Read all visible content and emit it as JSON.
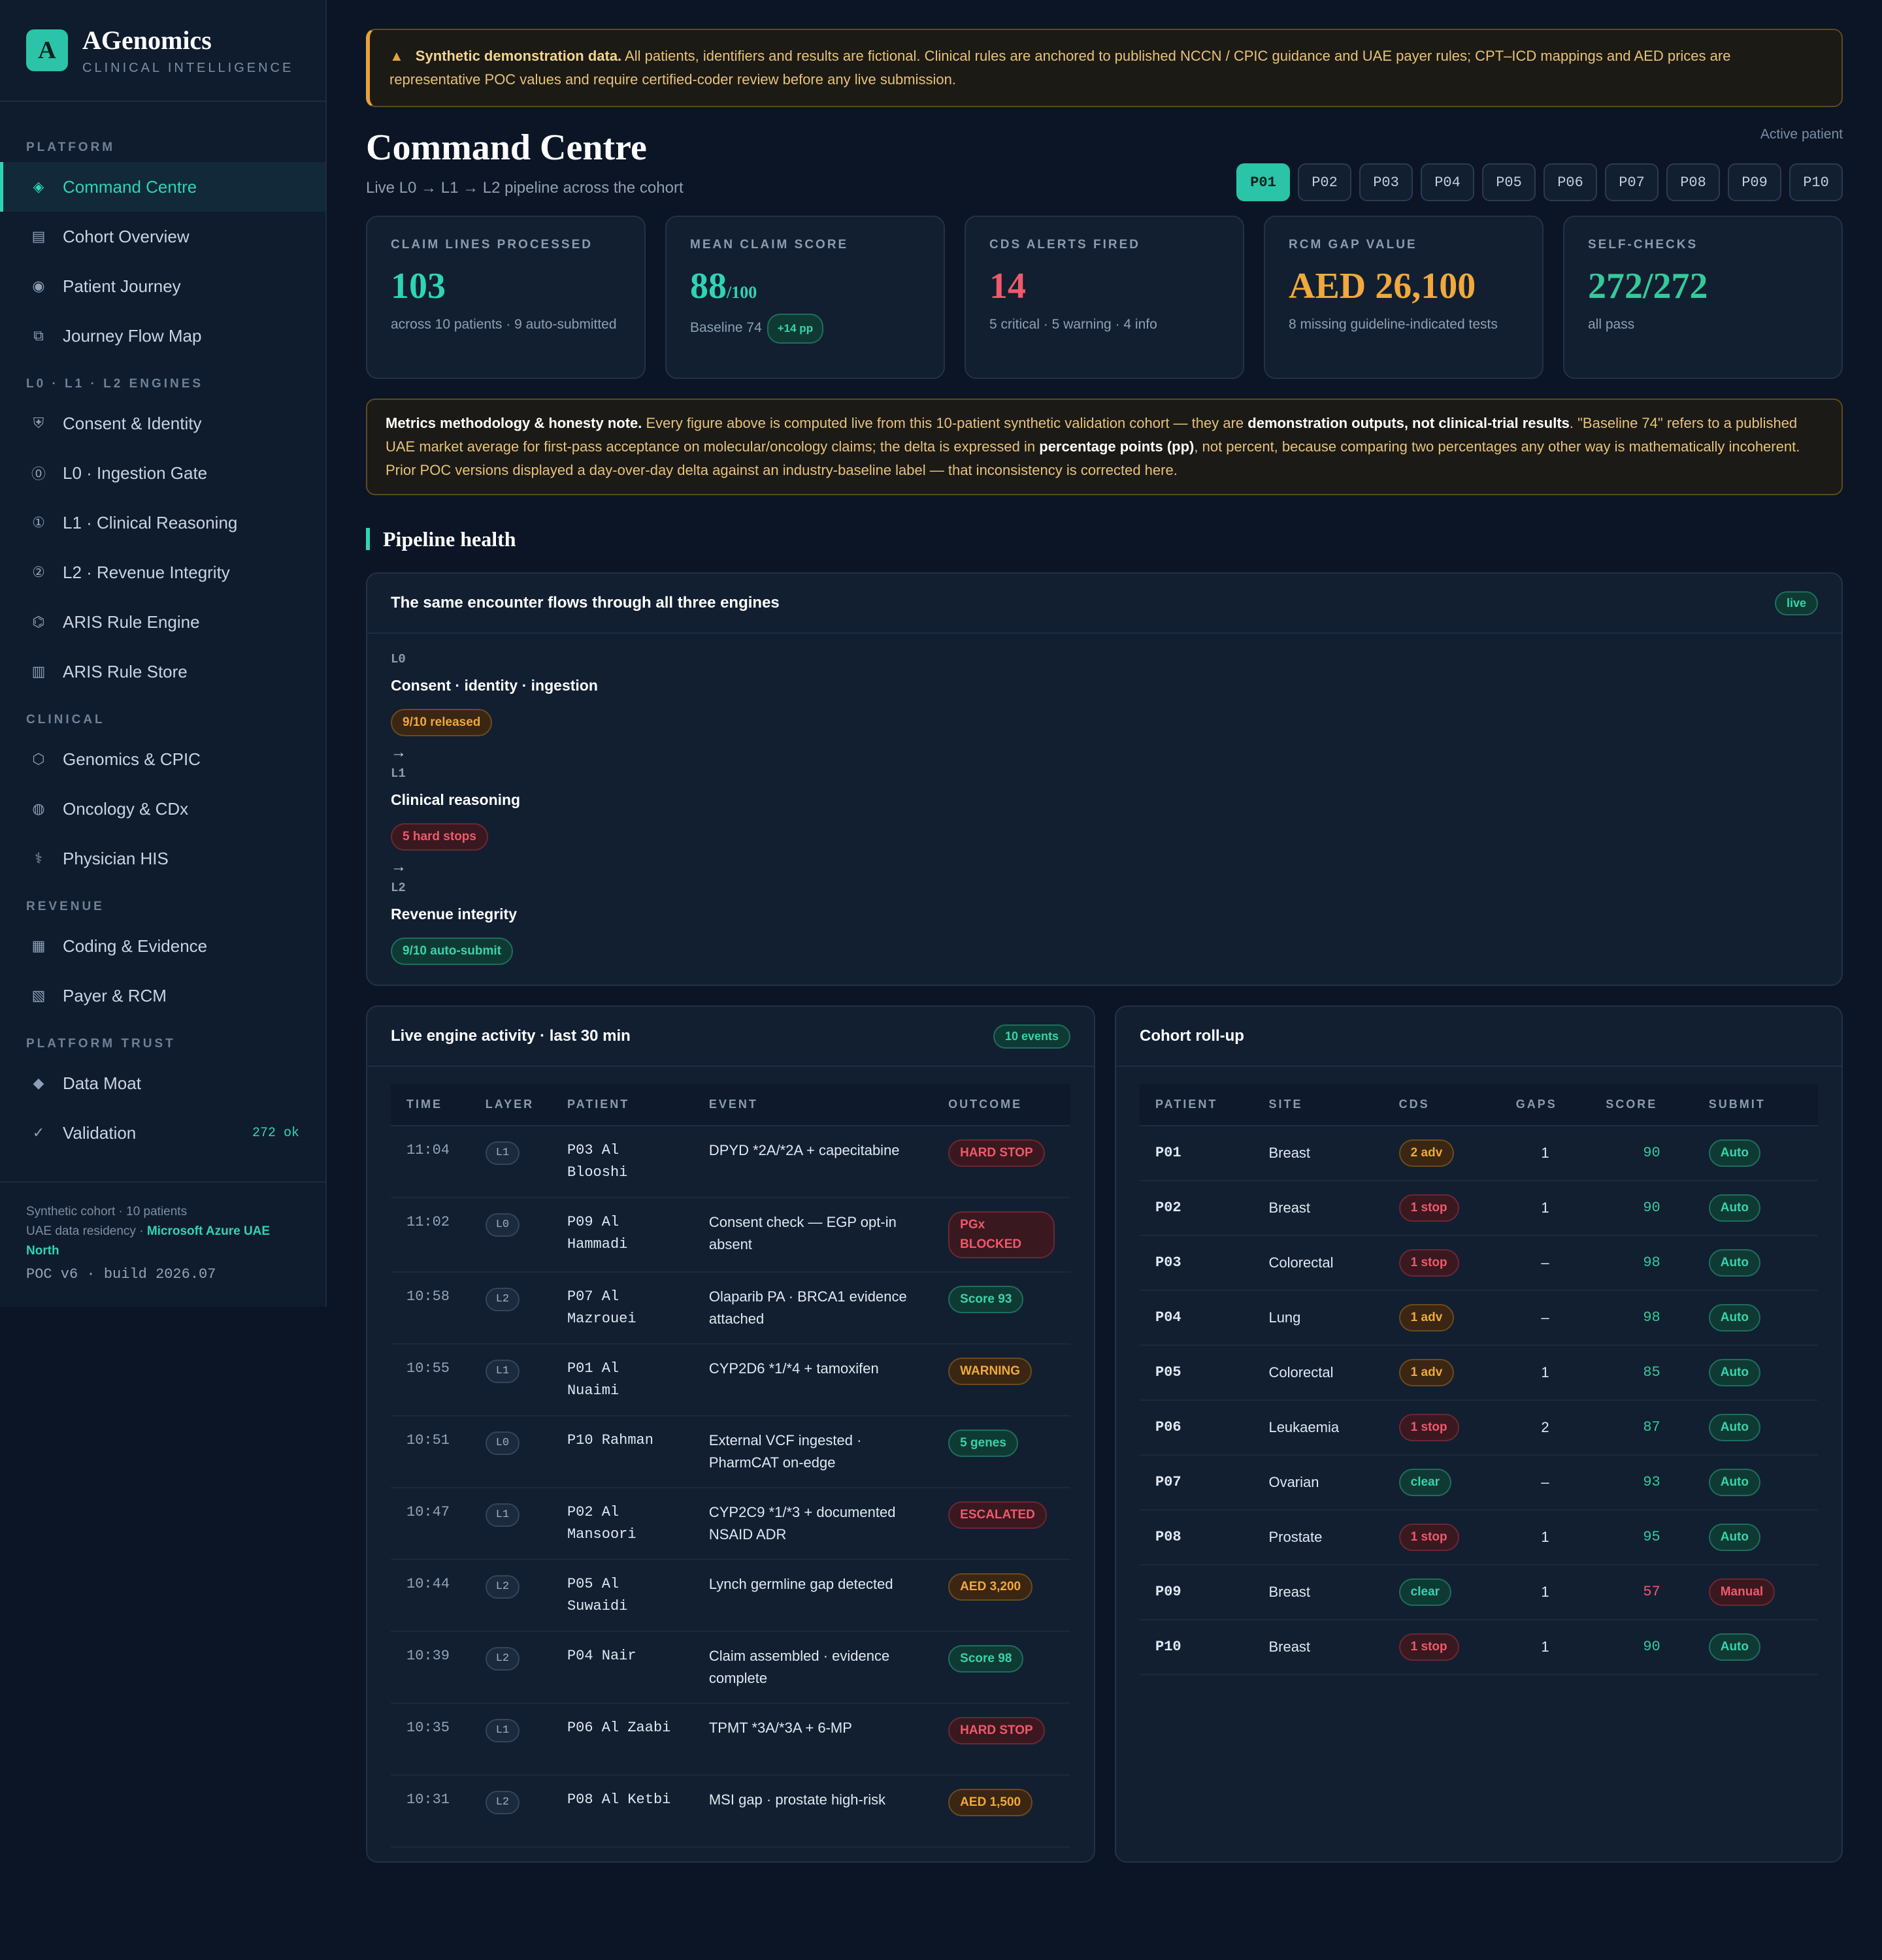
{
  "brand": {
    "logo_letter": "A",
    "title": "AGenomics",
    "subtitle": "CLINICAL INTELLIGENCE"
  },
  "sidebar": {
    "sections": [
      {
        "label": "PLATFORM",
        "items": [
          {
            "label": "Command Centre",
            "icon": "diamond-icon",
            "active": true
          },
          {
            "label": "Cohort Overview",
            "icon": "grid-icon"
          },
          {
            "label": "Patient Journey",
            "icon": "target-icon"
          },
          {
            "label": "Journey Flow Map",
            "icon": "layers-icon"
          }
        ]
      },
      {
        "label": "L0 · L1 · L2 ENGINES",
        "items": [
          {
            "label": "Consent & Identity",
            "icon": "shield-icon"
          },
          {
            "label": "L0 · Ingestion Gate",
            "icon": "circle-zero-icon"
          },
          {
            "label": "L1 · Clinical Reasoning",
            "icon": "circle-one-icon"
          },
          {
            "label": "L2 · Revenue Integrity",
            "icon": "circle-two-icon"
          },
          {
            "label": "ARIS Rule Engine",
            "icon": "hexagon-icon"
          },
          {
            "label": "ARIS Rule Store",
            "icon": "database-icon"
          }
        ]
      },
      {
        "label": "CLINICAL",
        "items": [
          {
            "label": "Genomics & CPIC",
            "icon": "hexagon-outline-icon"
          },
          {
            "label": "Oncology & CDx",
            "icon": "globe-icon"
          },
          {
            "label": "Physician HIS",
            "icon": "caduceus-icon"
          }
        ]
      },
      {
        "label": "REVENUE",
        "items": [
          {
            "label": "Coding & Evidence",
            "icon": "barcode-icon"
          },
          {
            "label": "Payer & RCM",
            "icon": "hatched-square-icon"
          }
        ]
      },
      {
        "label": "PLATFORM TRUST",
        "items": [
          {
            "label": "Data Moat",
            "icon": "diamond-solid-icon"
          },
          {
            "label": "Validation",
            "icon": "check-icon",
            "count": "272 ok"
          }
        ]
      }
    ],
    "footer": {
      "line1": "Synthetic cohort · 10 patients",
      "line2_prefix": "UAE data residency · ",
      "line2_highlight": "Microsoft Azure UAE North",
      "build": "POC v6 · build 2026.07"
    }
  },
  "banner": {
    "icon": "warning-icon",
    "bold": "Synthetic demonstration data.",
    "text": " All patients, identifiers and results are fictional. Clinical rules are anchored to published NCCN / CPIC guidance and UAE payer rules; CPT–ICD mappings and AED prices are representative POC values and require certified-coder review before any live submission."
  },
  "header": {
    "title": "Command Centre",
    "subtitle": "Live L0 → L1 → L2 pipeline across the cohort",
    "active_label": "Active patient",
    "patients": [
      "P01",
      "P02",
      "P03",
      "P04",
      "P05",
      "P06",
      "P07",
      "P08",
      "P09",
      "P10"
    ],
    "active_patient": "P01"
  },
  "kpis": [
    {
      "label": "CLAIM LINES PROCESSED",
      "value": "103",
      "note": "across 10 patients · 9 auto-submitted",
      "color": "#2fd4b4"
    },
    {
      "label": "MEAN CLAIM SCORE",
      "value": "88",
      "suffix": "/100",
      "note": "Baseline 74",
      "chip": "+14 pp",
      "color": "#2fd4b4"
    },
    {
      "label": "CDS ALERTS FIRED",
      "value": "14",
      "note": "5 critical · 5 warning · 4 info",
      "color": "#f0596a"
    },
    {
      "label": "RCM GAP VALUE",
      "value": "AED 26,100",
      "note": "8 missing guideline-indicated tests",
      "color": "#f0a93a"
    },
    {
      "label": "SELF-CHECKS",
      "value": "272/272",
      "note": "all pass",
      "color": "#35c99a"
    }
  ],
  "methodology": {
    "b1": "Metrics methodology & honesty note.",
    "t1": " Every figure above is computed live from this 10-patient synthetic validation cohort — they are ",
    "b2": "demonstration outputs, not clinical-trial results",
    "t2": ". \"Baseline 74\" refers to a published UAE market average for first-pass acceptance on molecular/oncology claims; the delta is expressed in ",
    "b3": "percentage points (pp)",
    "t3": ", not percent, because comparing two percentages any other way is mathematically incoherent. Prior POC versions displayed a day-over-day delta against an industry-baseline label — that inconsistency is corrected here."
  },
  "pipeline_section": {
    "title": "Pipeline health"
  },
  "pipeline": {
    "title": "The same encounter flows through all three engines",
    "tag": "live",
    "arrow": "→",
    "stages": [
      {
        "layer": "L0",
        "name": "Consent · identity · ingestion",
        "badge": "9/10 released",
        "tone": "amber"
      },
      {
        "layer": "L1",
        "name": "Clinical reasoning",
        "badge": "5 hard stops",
        "tone": "red"
      },
      {
        "layer": "L2",
        "name": "Revenue integrity",
        "badge": "9/10 auto-submit",
        "tone": "green"
      }
    ]
  },
  "activity": {
    "title": "Live engine activity · last 30 min",
    "tag": "10 events",
    "columns": [
      "TIME",
      "LAYER",
      "PATIENT",
      "EVENT",
      "OUTCOME"
    ],
    "rows": [
      {
        "time": "11:04",
        "layer": "L1",
        "patient": "P03 Al Blooshi",
        "event": "DPYD *2A/*2A + capecitabine",
        "outcome": "HARD STOP",
        "tone": "red"
      },
      {
        "time": "11:02",
        "layer": "L0",
        "patient": "P09 Al Hammadi",
        "event": "Consent check — EGP opt-in absent",
        "outcome": "PGx BLOCKED",
        "tone": "red"
      },
      {
        "time": "10:58",
        "layer": "L2",
        "patient": "P07 Al Mazrouei",
        "event": "Olaparib PA · BRCA1 evidence attached",
        "outcome": "Score 93",
        "tone": "green"
      },
      {
        "time": "10:55",
        "layer": "L1",
        "patient": "P01 Al Nuaimi",
        "event": "CYP2D6 *1/*4 + tamoxifen",
        "outcome": "WARNING",
        "tone": "amber"
      },
      {
        "time": "10:51",
        "layer": "L0",
        "patient": "P10 Rahman",
        "event": "External VCF ingested · PharmCAT on-edge",
        "outcome": "5 genes",
        "tone": "green"
      },
      {
        "time": "10:47",
        "layer": "L1",
        "patient": "P02 Al Mansoori",
        "event": "CYP2C9 *1/*3 + documented NSAID ADR",
        "outcome": "ESCALATED",
        "tone": "red"
      },
      {
        "time": "10:44",
        "layer": "L2",
        "patient": "P05 Al Suwaidi",
        "event": "Lynch germline gap detected",
        "outcome": "AED 3,200",
        "tone": "amber"
      },
      {
        "time": "10:39",
        "layer": "L2",
        "patient": "P04 Nair",
        "event": "Claim assembled · evidence complete",
        "outcome": "Score 98",
        "tone": "green"
      },
      {
        "time": "10:35",
        "layer": "L1",
        "patient": "P06 Al Zaabi",
        "event": "TPMT *3A/*3A + 6-MP",
        "outcome": "HARD STOP",
        "tone": "red"
      },
      {
        "time": "10:31",
        "layer": "L2",
        "patient": "P08 Al Ketbi",
        "event": "MSI gap · prostate high-risk",
        "outcome": "AED 1,500",
        "tone": "amber"
      }
    ]
  },
  "rollup": {
    "title": "Cohort roll-up",
    "columns": [
      "PATIENT",
      "SITE",
      "CDS",
      "GAPS",
      "SCORE",
      "SUBMIT"
    ],
    "rows": [
      {
        "patient": "P01",
        "site": "Breast",
        "cds": "2 adv",
        "cds_tone": "amber",
        "gaps": "1",
        "score": "90",
        "score_tone": "green",
        "submit": "Auto",
        "submit_tone": "green"
      },
      {
        "patient": "P02",
        "site": "Breast",
        "cds": "1 stop",
        "cds_tone": "red",
        "gaps": "1",
        "score": "90",
        "score_tone": "green",
        "submit": "Auto",
        "submit_tone": "green"
      },
      {
        "patient": "P03",
        "site": "Colorectal",
        "cds": "1 stop",
        "cds_tone": "red",
        "gaps": "–",
        "score": "98",
        "score_tone": "green",
        "submit": "Auto",
        "submit_tone": "green"
      },
      {
        "patient": "P04",
        "site": "Lung",
        "cds": "1 adv",
        "cds_tone": "amber",
        "gaps": "–",
        "score": "98",
        "score_tone": "green",
        "submit": "Auto",
        "submit_tone": "green"
      },
      {
        "patient": "P05",
        "site": "Colorectal",
        "cds": "1 adv",
        "cds_tone": "amber",
        "gaps": "1",
        "score": "85",
        "score_tone": "green",
        "submit": "Auto",
        "submit_tone": "green"
      },
      {
        "patient": "P06",
        "site": "Leukaemia",
        "cds": "1 stop",
        "cds_tone": "red",
        "gaps": "2",
        "score": "87",
        "score_tone": "green",
        "submit": "Auto",
        "submit_tone": "green"
      },
      {
        "patient": "P07",
        "site": "Ovarian",
        "cds": "clear",
        "cds_tone": "green",
        "gaps": "–",
        "score": "93",
        "score_tone": "green",
        "submit": "Auto",
        "submit_tone": "green"
      },
      {
        "patient": "P08",
        "site": "Prostate",
        "cds": "1 stop",
        "cds_tone": "red",
        "gaps": "1",
        "score": "95",
        "score_tone": "green",
        "submit": "Auto",
        "submit_tone": "green"
      },
      {
        "patient": "P09",
        "site": "Breast",
        "cds": "clear",
        "cds_tone": "green",
        "gaps": "1",
        "score": "57",
        "score_tone": "red",
        "submit": "Manual",
        "submit_tone": "red"
      },
      {
        "patient": "P10",
        "site": "Breast",
        "cds": "1 stop",
        "cds_tone": "red",
        "gaps": "1",
        "score": "90",
        "score_tone": "green",
        "submit": "Auto",
        "submit_tone": "green"
      }
    ]
  }
}
